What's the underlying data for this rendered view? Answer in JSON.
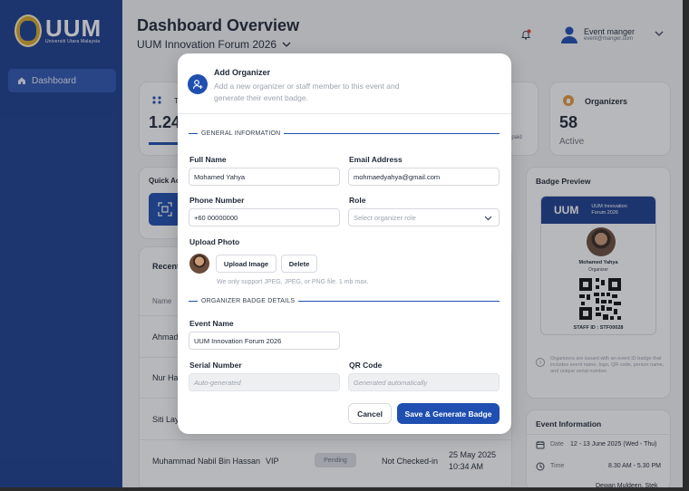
{
  "sidebar": {
    "logo_text": "UUM",
    "logo_sub": "Universiti Utara Malaysia",
    "nav": [
      {
        "label": "Dashboard",
        "icon": "home-icon"
      }
    ]
  },
  "header": {
    "title": "Dashboard Overview",
    "event": "UUM Innovation Forum 2026",
    "user_name": "Event manger",
    "user_email": "event@manger.uum"
  },
  "stats": {
    "card1_value": "1.24",
    "card1_label": "T",
    "card2_label": "t paid",
    "organizers_label": "Organizers",
    "organizers_value": "58",
    "organizers_status": "Active"
  },
  "quick_actions": {
    "title": "Quick Ac"
  },
  "recent": {
    "title": "Recent",
    "col_name": "Name",
    "rows": [
      {
        "name": "Ahmad"
      },
      {
        "name": "Nur Haz"
      },
      {
        "name": "Siti Layl"
      },
      {
        "name": "Muhammad Nabil Bin Hassan",
        "role": "VIP",
        "status": "Pending",
        "checkin": "Not Checked-in",
        "date": "25 May 2025",
        "time": "10:34 AM"
      }
    ]
  },
  "badge_preview": {
    "title": "Badge Preview",
    "logo": "UUM",
    "event": "UUM Innovation Forum 2026",
    "person": "Mohamed Yahya",
    "role": "Organizer",
    "staff_id": "STAFF ID : STF00028",
    "note": "Organizers are issued with an event ID badge that includes event name, logo, QR code, person name, and unique serial number."
  },
  "event_info": {
    "title": "Event Information",
    "date_label": "Date",
    "date_value": "12 - 13 June 2025 (Wed - Thu)",
    "time_label": "Time",
    "time_value": "8.30 AM - 5.30 PM",
    "venue_partial": "Dewan Muldeen, Stek"
  },
  "modal": {
    "title": "Add Organizer",
    "description": "Add a new organizer or staff member to this event and generate their event badge.",
    "section_general": "GENERAL INFORMATION",
    "full_name_label": "Full Name",
    "full_name_value": "Mohamed Yahya",
    "email_label": "Email Address",
    "email_value": "mohmaedyahya@gmail.com",
    "phone_label": "Phone Number",
    "phone_value": "+60 00000000",
    "role_label": "Role",
    "role_placeholder": "Select organizer role",
    "upload_label": "Upload Photo",
    "upload_button": "Upload Image",
    "delete_button": "Delete",
    "upload_hint": "We only support JPEG, JPEG, or PNG file. 1 mb max.",
    "section_badge": "ORGANIZER BADGE DETAILS",
    "event_name_label": "Event Name",
    "event_name_value": "UUM Innovation Forum 2026",
    "serial_label": "Serial Number",
    "serial_placeholder": "Auto-generated",
    "qr_label": "QR Code",
    "qr_placeholder": "Generated automatically",
    "cancel_button": "Cancel",
    "submit_button": "Save & Generate Badge"
  },
  "colors": {
    "primary": "#1f4fb0",
    "sidebar": "#1c3f8f",
    "notification": "#e53935"
  }
}
